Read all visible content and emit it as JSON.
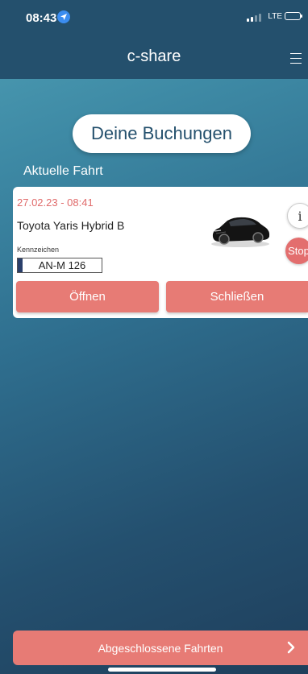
{
  "status_bar": {
    "time": "08:43",
    "network": "LTE"
  },
  "nav": {
    "title": "c-share"
  },
  "bookings_button": "Deine Buchungen",
  "current_trip": {
    "section_title": "Aktuelle Fahrt",
    "date": "27.02.23 - 08:41",
    "car": "Toyota Yaris Hybrid B",
    "plate_label": "Kennzeichen",
    "plate": "AN-M 126",
    "info_label": "i",
    "stop_label": "Stop",
    "open_label": "Öffnen",
    "close_label": "Schließen"
  },
  "bottom": {
    "label": "Abgeschlossene Fahrten"
  },
  "colors": {
    "bar": "#24506d",
    "accent": "#e77b75",
    "date": "#e06b6b"
  }
}
